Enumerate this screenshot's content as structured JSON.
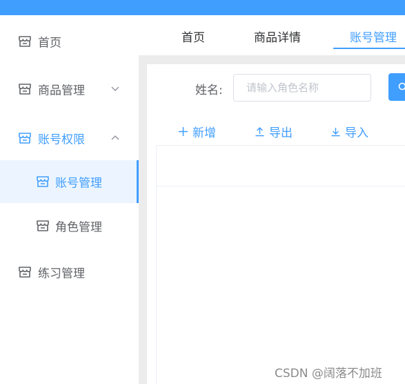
{
  "colors": {
    "accent": "#409eff",
    "text": "#606266",
    "selected_bg": "#ecf5ff"
  },
  "sidebar": {
    "items": [
      {
        "label": "首页",
        "icon": "store-icon"
      },
      {
        "label": "商品管理",
        "icon": "store-icon",
        "expanded": false
      },
      {
        "label": "账号权限",
        "icon": "store-icon",
        "expanded": true
      },
      {
        "label": "账号管理",
        "icon": "store-icon",
        "selected": true
      },
      {
        "label": "角色管理",
        "icon": "store-icon"
      },
      {
        "label": "练习管理",
        "icon": "store-icon"
      }
    ]
  },
  "tabs": [
    {
      "label": "首页"
    },
    {
      "label": "商品详情"
    },
    {
      "label": "账号管理",
      "active": true
    }
  ],
  "search": {
    "label": "姓名:",
    "placeholder": "请输入角色名称",
    "value": ""
  },
  "actions": {
    "add": "新增",
    "export": "导出",
    "import": "导入"
  },
  "watermark": "CSDN @阔落不加班"
}
